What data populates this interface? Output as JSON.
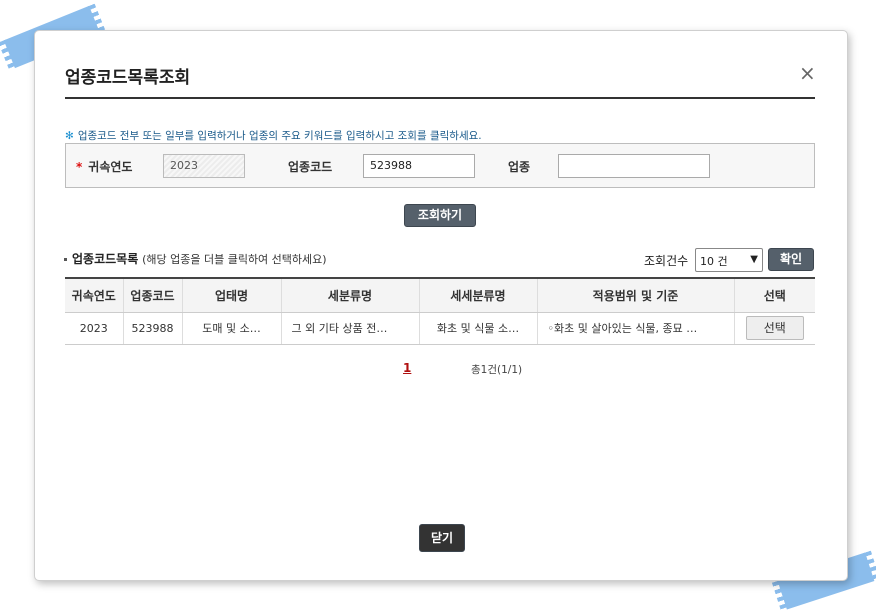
{
  "dialog": {
    "title": "업종코드목록조회",
    "close_icon": "×"
  },
  "guide": {
    "icon": "✻",
    "text": "업종코드 전부 또는 일부를 입력하거나 업종의 주요 키워드를 입력하시고 조회를 클릭하세요."
  },
  "search": {
    "year_required_mark": "*",
    "year_label": "귀속연도",
    "year_value": "2023",
    "code_label": "업종코드",
    "code_value": "523988",
    "industry_label": "업종",
    "industry_value": "",
    "search_button": "조회하기"
  },
  "list": {
    "title": "업종코드목록",
    "hint": "(해당 업종을 더블 클릭하여 선택하세요)",
    "count_label": "조회건수",
    "count_selected": "10 건",
    "confirm_button": "확인"
  },
  "table": {
    "headers": [
      "귀속연도",
      "업종코드",
      "업태명",
      "세분류명",
      "세세분류명",
      "적용범위 및 기준",
      "선택"
    ],
    "rows": [
      {
        "year": "2023",
        "code": "523988",
        "business_type": "도매 및 소…",
        "sub_category": "그 외 기타 상품 전…",
        "detail_category": "화초 및 식물 소…",
        "scope": "◦화초 및 살아있는 식물, 종묘 …",
        "select_button": "선택"
      }
    ]
  },
  "pagination": {
    "current_page": "1",
    "total": "총1건(1/1)"
  },
  "footer": {
    "close_button": "닫기"
  },
  "colors": {
    "dark_button": "#55606b",
    "required": "#dd1111",
    "guide_text": "#1a5a8a",
    "page_current": "#b01010"
  }
}
